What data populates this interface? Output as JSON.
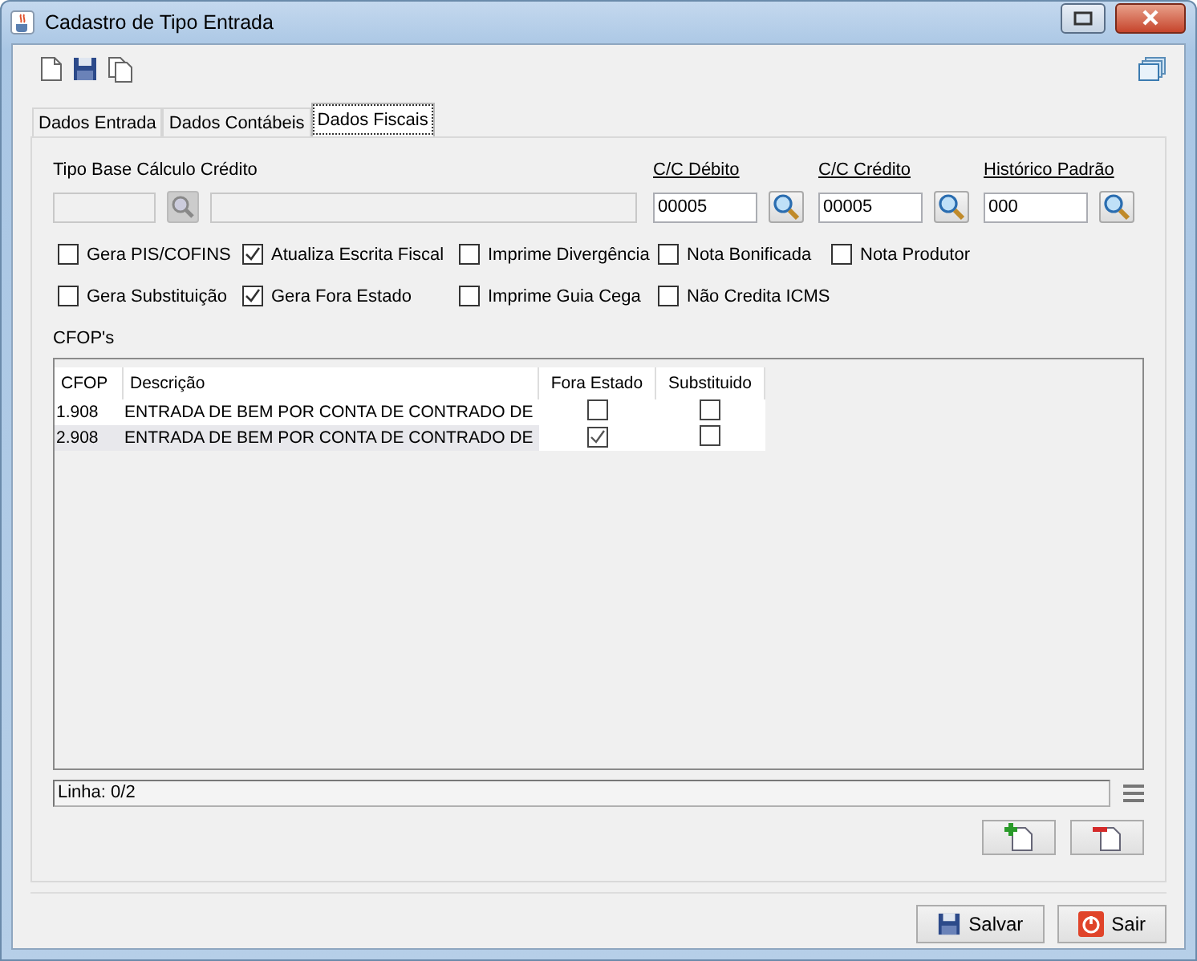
{
  "window": {
    "title": "Cadastro de Tipo Entrada"
  },
  "tabs": [
    {
      "label": "Dados Entrada",
      "selected": false
    },
    {
      "label": "Dados Contábeis",
      "selected": false
    },
    {
      "label": "Dados Fiscais",
      "selected": true
    }
  ],
  "tipo_base": {
    "label": "Tipo Base Cálculo Crédito",
    "disabled": true
  },
  "accounts": [
    {
      "label": "C/C Débito",
      "value": "00005"
    },
    {
      "label": "C/C Crédito",
      "value": "00005"
    },
    {
      "label": "Histórico Padrão",
      "value": "000"
    }
  ],
  "checkboxes": [
    {
      "label": "Gera PIS/COFINS",
      "checked": false
    },
    {
      "label": "Atualiza Escrita Fiscal",
      "checked": true
    },
    {
      "label": "Imprime Divergência",
      "checked": false
    },
    {
      "label": "Nota Bonificada",
      "checked": false
    },
    {
      "label": "Nota Produtor",
      "checked": false
    },
    {
      "label": "Gera Substituição",
      "checked": false
    },
    {
      "label": "Gera Fora Estado",
      "checked": true
    },
    {
      "label": "Imprime Guia Cega",
      "checked": false
    },
    {
      "label": "Não Credita ICMS",
      "checked": false
    }
  ],
  "cfops": {
    "label": "CFOP's",
    "columns": [
      "CFOP",
      "Descrição",
      "Fora Estado",
      "Substituido"
    ],
    "rows": [
      {
        "cfop": "1.908",
        "descricao": "ENTRADA DE BEM POR CONTA DE CONTRADO DE",
        "fora_estado": false,
        "substituido": false,
        "selected": false
      },
      {
        "cfop": "2.908",
        "descricao": "ENTRADA DE BEM POR CONTA DE CONTRADO DE",
        "fora_estado": true,
        "substituido": false,
        "selected": true
      }
    ]
  },
  "status": "Linha: 0/2",
  "buttons": [
    {
      "label": "Salvar",
      "kind": "save"
    },
    {
      "label": "Sair",
      "kind": "exit"
    }
  ]
}
